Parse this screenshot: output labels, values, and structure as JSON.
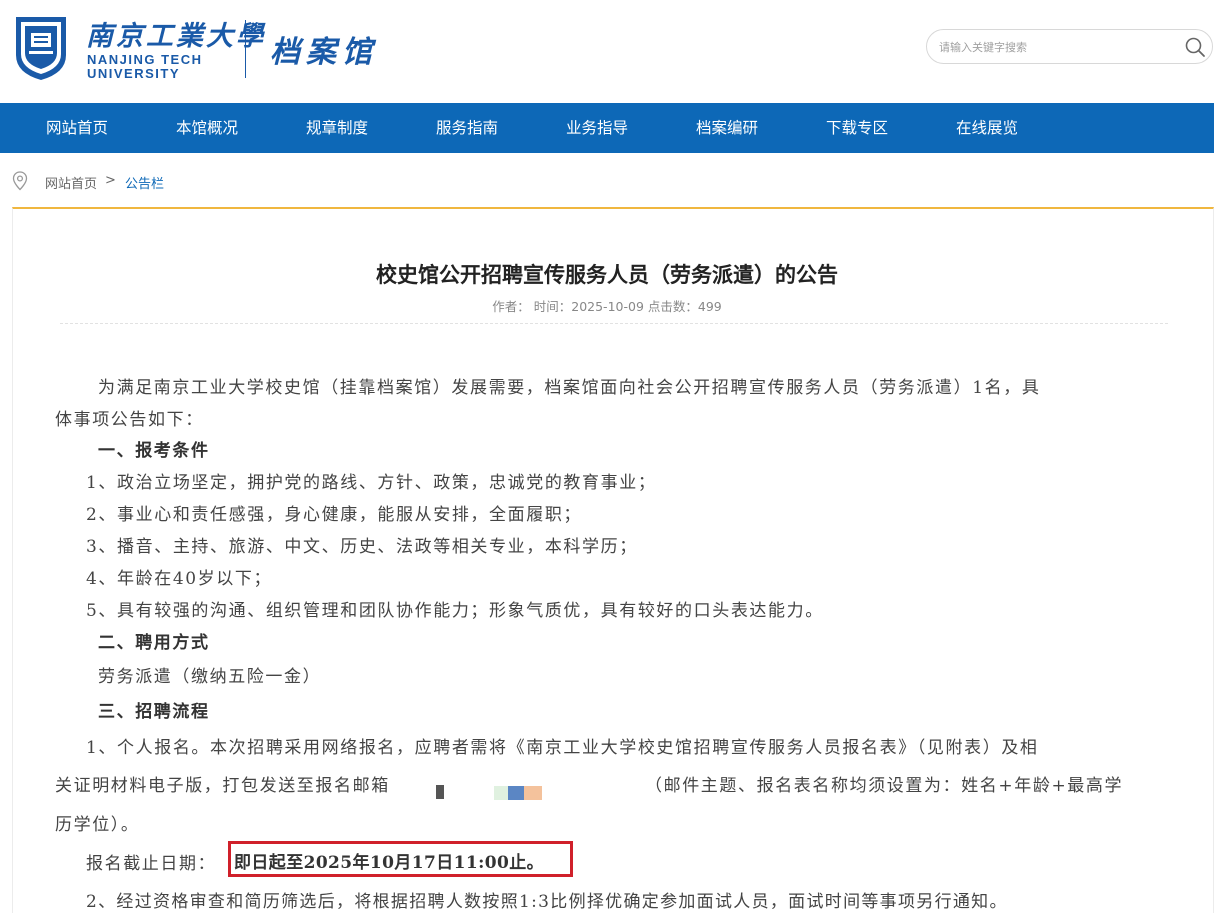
{
  "header": {
    "logo_cn": "南京工業大學",
    "logo_en_line1": "NANJING TECH",
    "logo_en_line2": "UNIVERSITY",
    "site_name": "档案馆",
    "search_placeholder": "请输入关键字搜索"
  },
  "nav": {
    "items": [
      {
        "label": "网站首页"
      },
      {
        "label": "本馆概况"
      },
      {
        "label": "规章制度"
      },
      {
        "label": "服务指南"
      },
      {
        "label": "业务指导"
      },
      {
        "label": "档案编研"
      },
      {
        "label": "下载专区"
      },
      {
        "label": "在线展览"
      }
    ]
  },
  "breadcrumb": {
    "home": "网站首页",
    "separator": ">",
    "current": "公告栏"
  },
  "article": {
    "title": "校史馆公开招聘宣传服务人员（劳务派遣）的公告",
    "meta_author_label": "作者：",
    "meta_time_label": "时间：",
    "meta_date": "2025-10-09",
    "meta_views_label": "点击数：",
    "meta_views": "499",
    "paragraphs": {
      "intro1": "为满足南京工业大学校史馆（挂靠档案馆）发展需要，档案馆面向社会公开招聘宣传服务人员（劳务派遣）1名，具",
      "intro2": "体事项公告如下：",
      "sec1": "一、报考条件",
      "c1": "1、政治立场坚定，拥护党的路线、方针、政策，忠诚党的教育事业；",
      "c2": "2、事业心和责任感强，身心健康，能服从安排，全面履职；",
      "c3": "3、播音、主持、旅游、中文、历史、法政等相关专业，本科学历；",
      "c4": "4、年龄在40岁以下；",
      "c5": "5、具有较强的沟通、组织管理和团队协作能力；形象气质优，具有较好的口头表达能力。",
      "sec2": "二、聘用方式",
      "employ": "劳务派遣（缴纳五险一金）",
      "sec3": "三、招聘流程",
      "s1a": "1、个人报名。本次招聘采用网络报名，应聘者需将《南京工业大学校史馆招聘宣传服务人员报名表》（见附表）及相",
      "s1b": "关证明材料电子版，打包发送至报名邮箱",
      "s1b_tail": "（邮件主题、报名表名称均须设置为：姓名+年龄+最高学",
      "s1c": "历学位）。",
      "deadline_label": "报名截止日期：",
      "deadline_value": "即日起至2025年10月17日11:00止。",
      "s2": "2、经过资格审查和简历筛选后，将根据招聘人数按照1:3比例择优确定参加面试人员，面试时间等事项另行通知。"
    }
  },
  "colors": {
    "brand_blue": "#0d68b7",
    "accent_gold": "#f0b73f",
    "highlight_red": "#d0202a"
  }
}
